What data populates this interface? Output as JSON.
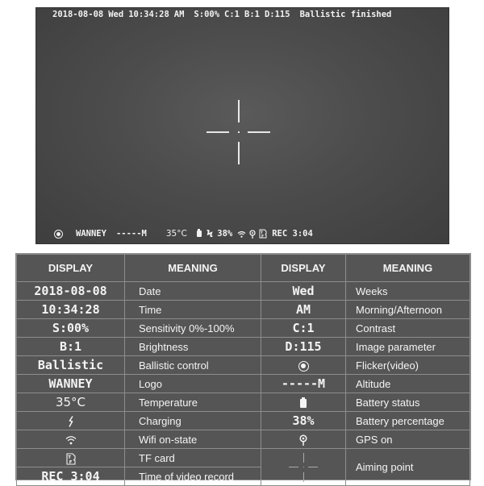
{
  "scope": {
    "top_bar": {
      "date": "2018-08-08",
      "weekday": "Wed",
      "time": "10:34:28",
      "ampm": "AM",
      "sensitivity": "S:00%",
      "contrast": "C:1",
      "brightness": "B:1",
      "image_param": "D:115",
      "status": "Ballistic finished"
    },
    "bottom_bar": {
      "flicker_icon": "flicker-record-icon",
      "logo": "WANNEY",
      "altitude": "-----M",
      "temperature": "35°C",
      "battery_icon": "battery-icon",
      "charging_icon": "lightning-icon",
      "battery_percent": "38%",
      "wifi_icon": "wifi-icon",
      "gps_icon": "gps-pin-icon",
      "tf_icon": "tf-card-icon",
      "rec": "REC 3:04"
    }
  },
  "legend": {
    "headers": [
      "DISPLAY",
      "MEANING",
      "DISPLAY",
      "MEANING"
    ],
    "left": [
      {
        "display": "2018-08-08",
        "meaning": "Date"
      },
      {
        "display": "10:34:28",
        "meaning": "Time"
      },
      {
        "display": "S:00%",
        "meaning": "Sensitivity 0%-100%"
      },
      {
        "display": "B:1",
        "meaning": "Brightness"
      },
      {
        "display": "Ballistic",
        "meaning": "Ballistic control"
      },
      {
        "display": "WANNEY",
        "meaning": "Logo"
      },
      {
        "display": "35°C",
        "meaning": "Temperature"
      },
      {
        "display_icon": "lightning-icon",
        "meaning": "Charging"
      },
      {
        "display_icon": "wifi-icon",
        "meaning": "Wifi on-state"
      },
      {
        "display_icon": "tf-card-icon",
        "meaning": "TF card"
      },
      {
        "display": "REC 3:04",
        "meaning": "Time of video record"
      }
    ],
    "right": [
      {
        "display": "Wed",
        "meaning": "Weeks"
      },
      {
        "display": "AM",
        "meaning": "Morning/Afternoon"
      },
      {
        "display": "C:1",
        "meaning": "Contrast"
      },
      {
        "display": "D:115",
        "meaning": "Image parameter"
      },
      {
        "display_icon": "flicker-record-icon",
        "meaning": "Flicker(video)"
      },
      {
        "display": "-----M",
        "meaning": "Altitude"
      },
      {
        "display_icon": "battery-icon",
        "meaning": "Battery status"
      },
      {
        "display": "38%",
        "meaning": "Battery percentage"
      },
      {
        "display_icon": "gps-pin-icon",
        "meaning": "GPS on"
      },
      {
        "display_icon": "crosshair-icon",
        "meaning": "Aiming point"
      }
    ]
  }
}
